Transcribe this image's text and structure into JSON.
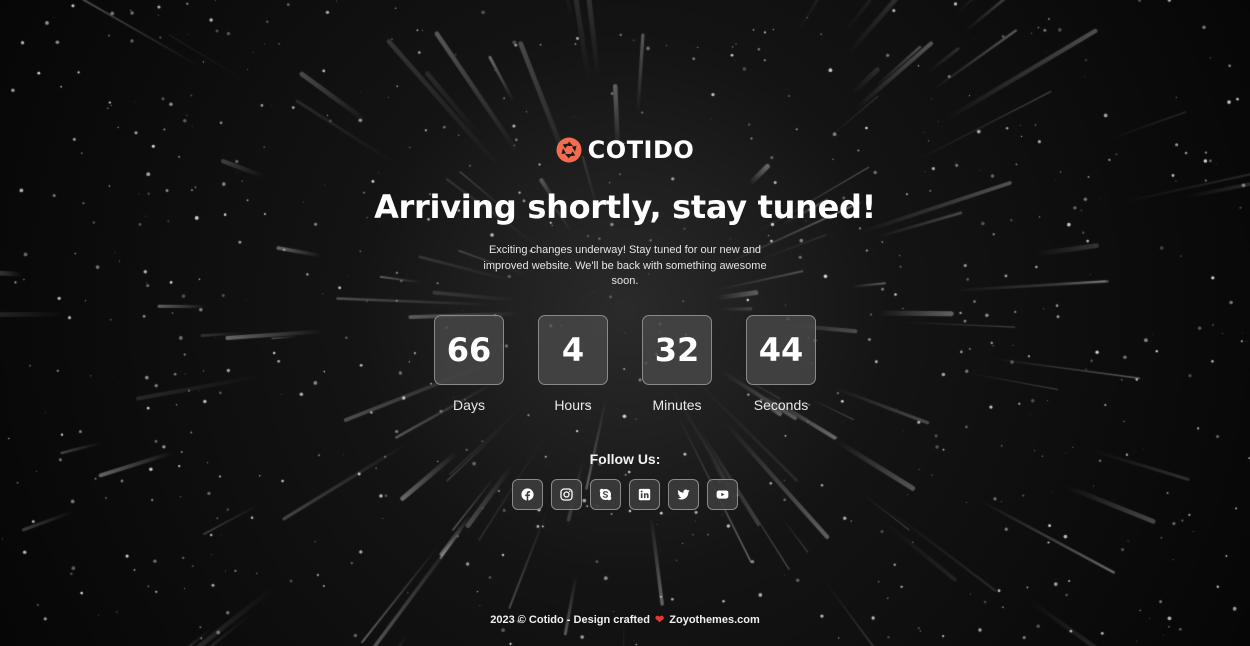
{
  "brand": {
    "name": "COTIDO",
    "logo_icon": "aperture-icon",
    "logo_color": "#f26c4f"
  },
  "headline": "Arriving shortly, stay tuned!",
  "description": "Exciting changes underway! Stay tuned for our new and improved website. We'll be back with something awesome soon.",
  "countdown": [
    {
      "value": "66",
      "label": "Days"
    },
    {
      "value": "4",
      "label": "Hours"
    },
    {
      "value": "32",
      "label": "Minutes"
    },
    {
      "value": "44",
      "label": "Seconds"
    }
  ],
  "follow": {
    "title": "Follow Us:",
    "icons": [
      "facebook-icon",
      "instagram-icon",
      "skype-icon",
      "linkedin-icon",
      "twitter-icon",
      "youtube-icon"
    ]
  },
  "footer": {
    "prefix": "2023 © Cotido - Design crafted",
    "heart": "❤",
    "suffix": "Zoyothemes.com",
    "heart_color": "#e53935"
  }
}
